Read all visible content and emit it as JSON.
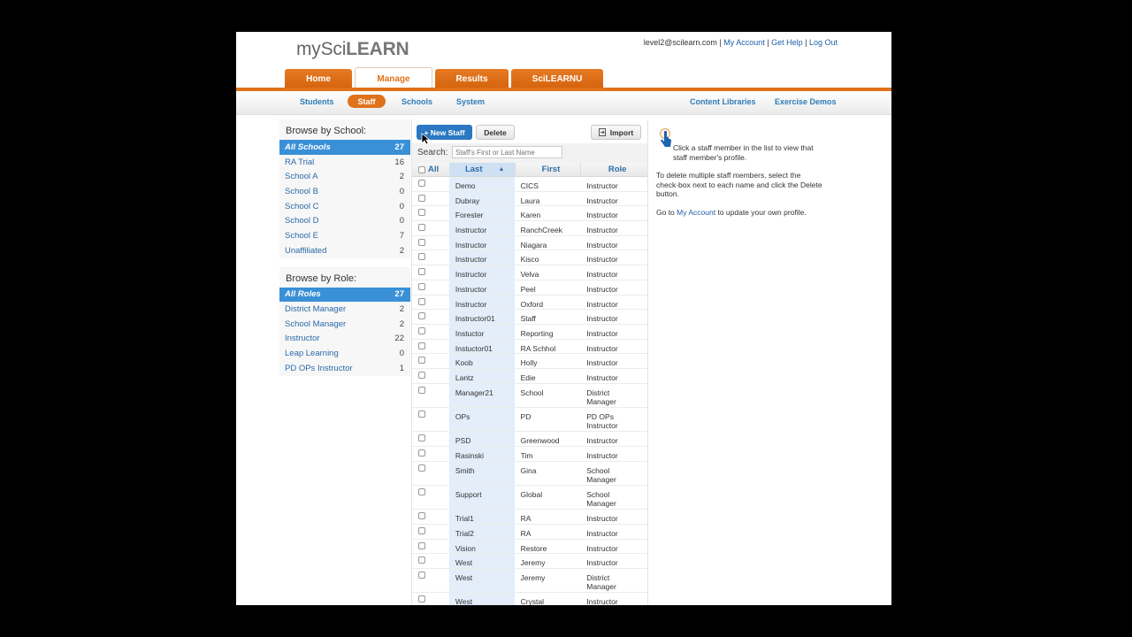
{
  "header": {
    "logo_prefix": "mySci",
    "logo_suffix": "LEARN",
    "user_email": "level2@scilearn.com",
    "sep1": " | ",
    "my_account": "My Account",
    "sep2": " | ",
    "get_help": "Get Help",
    "sep3": " | ",
    "log_out": "Log Out"
  },
  "tabs": [
    {
      "label": "Home",
      "active": false
    },
    {
      "label": "Manage",
      "active": true
    },
    {
      "label": "Results",
      "active": false
    },
    {
      "label": "SciLEARNU",
      "active": false
    }
  ],
  "subnav": {
    "students": "Students",
    "staff": "Staff",
    "schools": "Schools",
    "system": "System",
    "content_libraries": "Content Libraries",
    "exercise_demos": "Exercise Demos"
  },
  "browse_school": {
    "title": "Browse by School:",
    "items": [
      {
        "label": "All Schools",
        "count": "27"
      },
      {
        "label": "RA Trial",
        "count": "16"
      },
      {
        "label": "School A",
        "count": "2"
      },
      {
        "label": "School B",
        "count": "0"
      },
      {
        "label": "School C",
        "count": "0"
      },
      {
        "label": "School D",
        "count": "0"
      },
      {
        "label": "School E",
        "count": "7"
      },
      {
        "label": "Unaffiliated",
        "count": "2"
      }
    ]
  },
  "browse_role": {
    "title": "Browse by Role:",
    "items": [
      {
        "label": "All Roles",
        "count": "27"
      },
      {
        "label": "District Manager",
        "count": "2"
      },
      {
        "label": "School Manager",
        "count": "2"
      },
      {
        "label": "Instructor",
        "count": "22"
      },
      {
        "label": "Leap Learning",
        "count": "0"
      },
      {
        "label": "PD OPs Instructor",
        "count": "1"
      }
    ]
  },
  "toolbar": {
    "new_staff": "+ New Staff",
    "delete": "Delete",
    "import": "Import"
  },
  "search": {
    "label": "Search:",
    "placeholder": "Staff's First or Last Name"
  },
  "table": {
    "headers": {
      "all": "All",
      "last": "Last",
      "first": "First",
      "role": "Role"
    },
    "rows": [
      {
        "last": "Demo",
        "first": "CICS",
        "role": "Instructor"
      },
      {
        "last": "Dubray",
        "first": "Laura",
        "role": "Instructor"
      },
      {
        "last": "Forester",
        "first": "Karen",
        "role": "Instructor"
      },
      {
        "last": "Instructor",
        "first": "RanchCreek",
        "role": "Instructor"
      },
      {
        "last": "Instructor",
        "first": "Niagara",
        "role": "Instructor"
      },
      {
        "last": "Instructor",
        "first": "Kisco",
        "role": "Instructor"
      },
      {
        "last": "Instructor",
        "first": "Velva",
        "role": "Instructor"
      },
      {
        "last": "Instructor",
        "first": "Peel",
        "role": "Instructor"
      },
      {
        "last": "Instructor",
        "first": "Oxford",
        "role": "Instructor"
      },
      {
        "last": "Instructor01",
        "first": "Staff",
        "role": "Instructor"
      },
      {
        "last": "Instuctor",
        "first": "Reporting",
        "role": "Instructor"
      },
      {
        "last": "Instuctor01",
        "first": "RA Schhol",
        "role": "Instructor"
      },
      {
        "last": "Koob",
        "first": "Holly",
        "role": "Instructor"
      },
      {
        "last": "Lantz",
        "first": "Edie",
        "role": "Instructor"
      },
      {
        "last": "Manager21",
        "first": "School",
        "role": "District Manager"
      },
      {
        "last": "OPs",
        "first": "PD",
        "role": "PD OPs Instructor"
      },
      {
        "last": "PSD",
        "first": "Greenwood",
        "role": "Instructor"
      },
      {
        "last": "Rasinski",
        "first": "Tim",
        "role": "Instructor"
      },
      {
        "last": "Smith",
        "first": "Gina",
        "role": "School Manager"
      },
      {
        "last": "Support",
        "first": "Global",
        "role": "School Manager"
      },
      {
        "last": "Trial1",
        "first": "RA",
        "role": "Instructor"
      },
      {
        "last": "Trial2",
        "first": "RA",
        "role": "Instructor"
      },
      {
        "last": "Vision",
        "first": "Restore",
        "role": "Instructor"
      },
      {
        "last": "West",
        "first": "Jeremy",
        "role": "Instructor"
      },
      {
        "last": "West",
        "first": "Jeremy",
        "role": "District Manager"
      },
      {
        "last": "West",
        "first": "Crystal",
        "role": "Instructor"
      }
    ]
  },
  "help": {
    "p1": "Click a staff member in the list to view that staff member's profile.",
    "p2": "To delete multiple staff members, select the check-box next to each name and click the Delete button.",
    "p3_pre": "Go to ",
    "p3_link": "My Account",
    "p3_post": " to update your own profile."
  },
  "colors": {
    "accent": "#e0721a",
    "selected": "#3a90d6",
    "link": "#1f5fa8"
  }
}
